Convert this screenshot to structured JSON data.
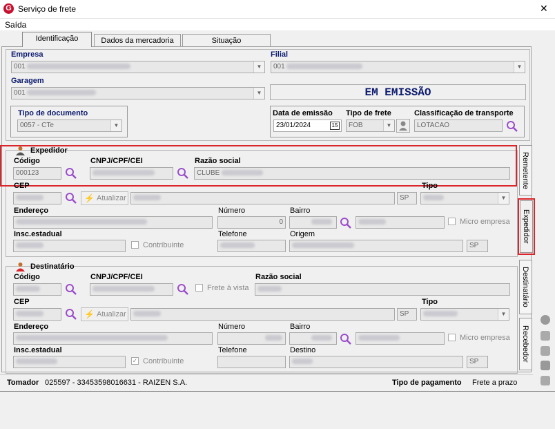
{
  "window": {
    "title": "Serviço de frete",
    "close": "✕"
  },
  "menu": {
    "saida": "Saída"
  },
  "tabs": [
    {
      "label": "Identificação"
    },
    {
      "label": "Dados da mercadoria"
    },
    {
      "label": "Situação"
    }
  ],
  "header": {
    "empresa_label": "Empresa",
    "empresa_value": "001",
    "filial_label": "Filial",
    "filial_value": "001",
    "garagem_label": "Garagem",
    "garagem_value": "001",
    "status": "EM EMISSÃO",
    "tipo_doc_label": "Tipo de documento",
    "tipo_doc_value": "0057 - CTe",
    "data_emissao_label": "Data de emissão",
    "data_emissao_value": "23/01/2024",
    "calendar_day": "15",
    "tipo_frete_label": "Tipo de frete",
    "tipo_frete_value": "FOB",
    "classificacao_label": "Classificação de transporte",
    "classificacao_value": "LOTACAO"
  },
  "expedidor": {
    "title": "Expedidor",
    "codigo_label": "Código",
    "codigo_value": "000123",
    "cnpj_label": "CNPJ/CPF/CEI",
    "razao_label": "Razão social",
    "razao_value": "CLUBE",
    "cep_label": "CEP",
    "atualizar": "Atualizar",
    "uf_value": "SP",
    "tipo_label": "Tipo",
    "endereco_label": "Endereço",
    "numero_label": "Número",
    "numero_value": "0",
    "bairro_label": "Bairro",
    "micro_empresa": "Micro empresa",
    "insc_label": "Insc.estadual",
    "contribuinte": "Contribuinte",
    "telefone_label": "Telefone",
    "origem_label": "Origem",
    "origem_uf": "SP"
  },
  "destinatario": {
    "title": "Destinatário",
    "codigo_label": "Código",
    "cnpj_label": "CNPJ/CPF/CEI",
    "frete_vista": "Frete à vista",
    "razao_label": "Razão social",
    "cep_label": "CEP",
    "atualizar": "Atualizar",
    "uf_value": "SP",
    "tipo_label": "Tipo",
    "endereco_label": "Endereço",
    "numero_label": "Número",
    "bairro_label": "Bairro",
    "micro_empresa": "Micro empresa",
    "insc_label": "Insc.estadual",
    "contribuinte": "Contribuinte",
    "telefone_label": "Telefone",
    "destino_label": "Destino",
    "destino_uf": "SP"
  },
  "vtabs": [
    {
      "label": "Remetente"
    },
    {
      "label": "Expedidor"
    },
    {
      "label": "Destinatário"
    },
    {
      "label": "Recebedor"
    }
  ],
  "footer": {
    "tomador_label": "Tomador",
    "tomador_value": "025597 - 33453598016631 - RAIZEN S.A.",
    "pagamento_label": "Tipo de pagamento",
    "pagamento_value": "Frete a prazo"
  },
  "colors": {
    "accent": "#0b1a6e",
    "highlight": "#d9262d",
    "magnifier": "#9b4dca"
  }
}
